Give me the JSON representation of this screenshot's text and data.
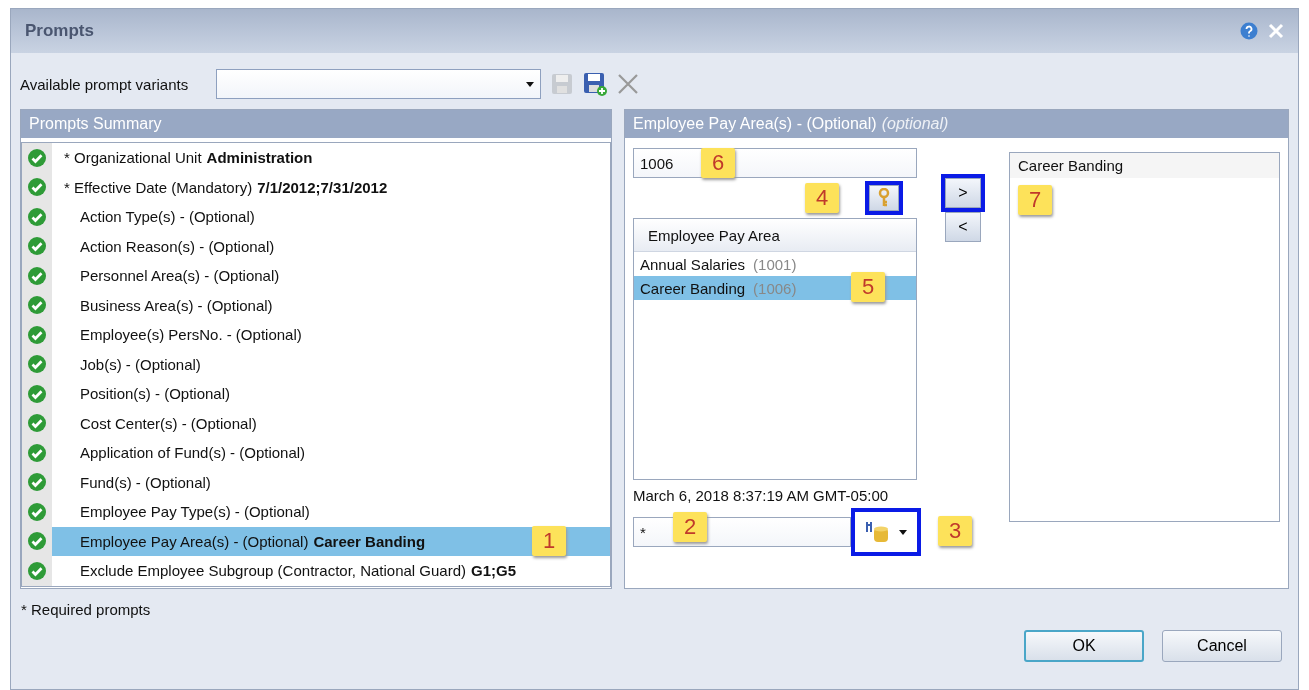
{
  "window": {
    "title": "Prompts"
  },
  "variants": {
    "label": "Available prompt variants"
  },
  "summary": {
    "title": "Prompts Summary",
    "rows": [
      {
        "label": "* Organizational Unit",
        "value": "Administration",
        "required": true,
        "selected": false
      },
      {
        "label": "* Effective Date (Mandatory)",
        "value": "7/1/2012;7/31/2012",
        "required": true,
        "selected": false
      },
      {
        "label": "Action Type(s) - (Optional)",
        "required": false,
        "selected": false
      },
      {
        "label": "Action Reason(s) - (Optional)",
        "required": false,
        "selected": false
      },
      {
        "label": "Personnel Area(s) - (Optional)",
        "required": false,
        "selected": false
      },
      {
        "label": "Business Area(s) - (Optional)",
        "required": false,
        "selected": false
      },
      {
        "label": "Employee(s) PersNo. - (Optional)",
        "required": false,
        "selected": false
      },
      {
        "label": "Job(s) - (Optional)",
        "required": false,
        "selected": false
      },
      {
        "label": "Position(s) - (Optional)",
        "required": false,
        "selected": false
      },
      {
        "label": "Cost Center(s) - (Optional)",
        "required": false,
        "selected": false
      },
      {
        "label": "Application of Fund(s) - (Optional)",
        "required": false,
        "selected": false
      },
      {
        "label": "Fund(s) - (Optional)",
        "required": false,
        "selected": false
      },
      {
        "label": "Employee Pay Type(s) - (Optional)",
        "required": false,
        "selected": false
      },
      {
        "label": "Employee Pay Area(s) - (Optional)",
        "value": "Career Banding",
        "required": false,
        "selected": true,
        "callout": "1"
      },
      {
        "label": "Exclude Employee Subgroup (Contractor, National Guard)",
        "value": "G1;G5",
        "required": false,
        "selected": false
      }
    ]
  },
  "detail": {
    "title": "Employee Pay Area(s) - (Optional)",
    "title_note": "(optional)",
    "search_value": "1006",
    "search_callout": "6",
    "key_button": {
      "highlighted": true,
      "callout": "4"
    },
    "list_header": "Employee Pay Area",
    "items": [
      {
        "name": "Annual Salaries",
        "code": "(1001)",
        "selected": false
      },
      {
        "name": "Career Banding",
        "code": "(1006)",
        "selected": true,
        "callout": "5"
      }
    ],
    "timestamp": "March 6, 2018 8:37:19 AM GMT-05:00",
    "filter_value": "*",
    "filter_callout": "2",
    "db_button": {
      "highlighted": true,
      "callout": "3"
    },
    "move_buttons": [
      {
        "label": ">",
        "highlighted": true
      },
      {
        "label": "<",
        "highlighted": false
      }
    ],
    "chosen": [
      {
        "name": "Career Banding"
      }
    ],
    "chosen_callout": "7"
  },
  "footnote": "* Required prompts",
  "buttons": [
    {
      "label": "OK",
      "default": true
    },
    {
      "label": "Cancel",
      "default": false
    }
  ]
}
